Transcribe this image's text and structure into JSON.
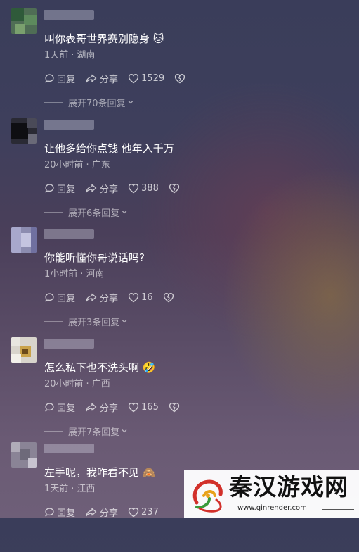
{
  "comments": [
    {
      "text": "叫你表哥世界赛别隐身",
      "emoji": "🐱",
      "time": "1天前",
      "location": "湖南",
      "reply_label": "回复",
      "share_label": "分享",
      "likes": "1529",
      "expand_label": "展开70条回复"
    },
    {
      "text": "让他多给你点钱 他年入千万",
      "emoji": "",
      "time": "20小时前",
      "location": "广东",
      "reply_label": "回复",
      "share_label": "分享",
      "likes": "388",
      "expand_label": "展开6条回复"
    },
    {
      "text": "你能听懂你哥说话吗?",
      "emoji": "",
      "time": "1小时前",
      "location": "河南",
      "reply_label": "回复",
      "share_label": "分享",
      "likes": "16",
      "expand_label": "展开3条回复"
    },
    {
      "text": "怎么私下也不洗头啊",
      "emoji": "🤣",
      "time": "20小时前",
      "location": "广西",
      "reply_label": "回复",
      "share_label": "分享",
      "likes": "165",
      "expand_label": "展开7条回复"
    },
    {
      "text": "左手呢，我咋看不见",
      "emoji": "🙈",
      "time": "1天前",
      "location": "江西",
      "reply_label": "回复",
      "share_label": "分享",
      "likes": "237",
      "expand_label": ""
    }
  ],
  "meta_separator": "·",
  "watermark": {
    "title": "秦汉游戏网",
    "url": "www.qinrender.com"
  },
  "colors": {
    "text": "#ffffff",
    "meta": "#b9b6c6",
    "watermark_bg": "#ffffff"
  }
}
